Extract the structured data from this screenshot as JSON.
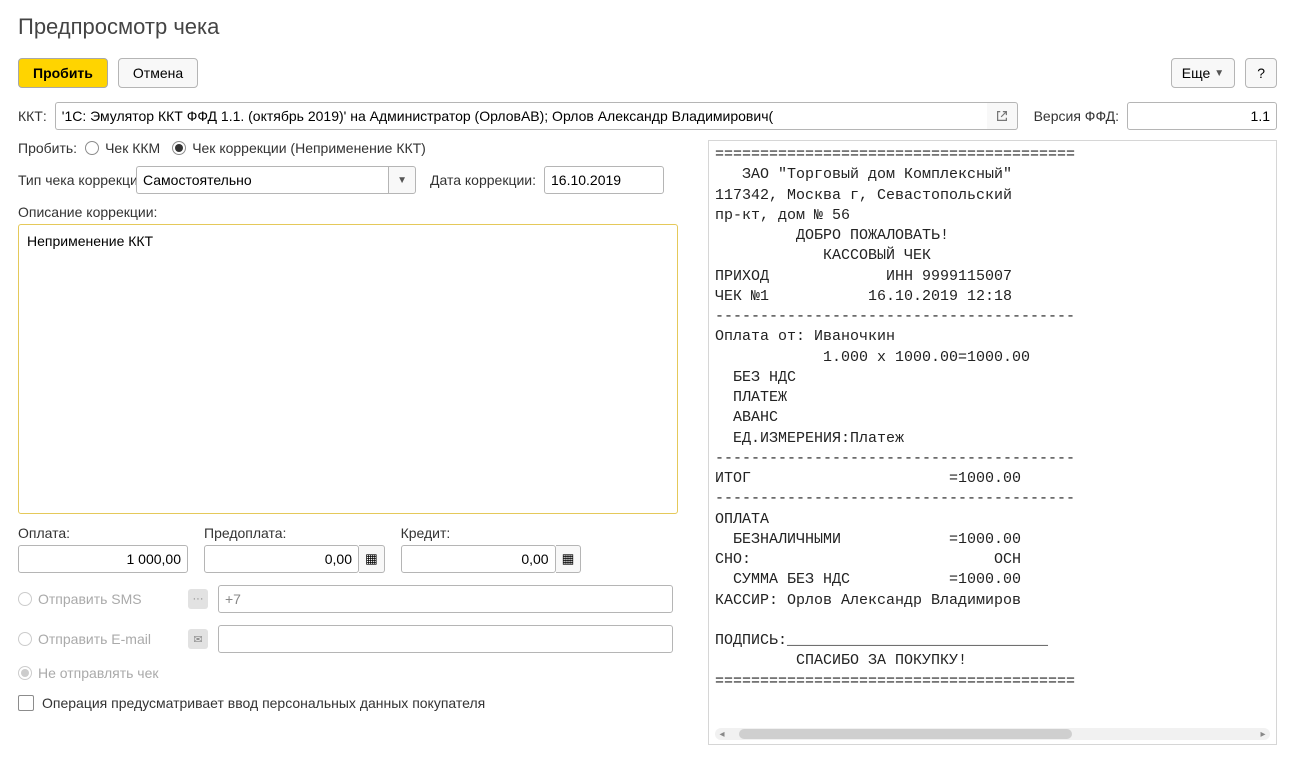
{
  "title": "Предпросмотр чека",
  "toolbar": {
    "punch": "Пробить",
    "cancel": "Отмена",
    "more": "Еще",
    "help": "?"
  },
  "kkt": {
    "label": "ККТ:",
    "value": "'1С: Эмулятор ККТ ФФД 1.1. (октябрь 2019)' на Администратор (ОрловАВ); Орлов Александр Владимирович(",
    "version_label": "Версия ФФД:",
    "version_value": "1.1"
  },
  "punch_mode": {
    "label": "Пробить:",
    "opt_kkm": "Чек ККМ",
    "opt_corr": "Чек коррекции (Неприменение ККТ)"
  },
  "corr": {
    "type_label": "Тип чека коррекции:",
    "type_value": "Самостоятельно",
    "date_label": "Дата коррекции:",
    "date_value": "16.10.2019",
    "desc_label": "Описание коррекции:",
    "desc_value": "Неприменение ККТ"
  },
  "amounts": {
    "pay_label": "Оплата:",
    "pay_value": "1 000,00",
    "prepay_label": "Предоплата:",
    "prepay_value": "0,00",
    "credit_label": "Кредит:",
    "credit_value": "0,00"
  },
  "send": {
    "sms_label": "Отправить SMS",
    "sms_value": "+7",
    "email_label": "Отправить E-mail",
    "none_label": "Не отправлять чек"
  },
  "personal": {
    "label": "Операция предусматривает ввод персональных данных покупателя"
  },
  "receipt_text": "========================================\n   ЗАО \"Торговый дом Комплексный\"\n117342, Москва г, Севастопольский \nпр-кт, дом № 56\n         ДОБРО ПОЖАЛОВАТЬ!\n            КАССОВЫЙ ЧЕК\nПРИХОД             ИНН 9999115007\nЧЕК №1           16.10.2019 12:18\n----------------------------------------\nОплата от: Иваночкин\n            1.000 x 1000.00=1000.00\n  БЕЗ НДС\n  ПЛАТЕЖ\n  АВАНС\n  ЕД.ИЗМЕРЕНИЯ:Платеж\n----------------------------------------\nИТОГ                      =1000.00\n----------------------------------------\nОПЛАТА\n  БЕЗНАЛИЧНЫМИ            =1000.00\nСНО:                           ОСН\n  СУММА БЕЗ НДС           =1000.00\nКАССИР: Орлов Александр Владимиров\n\nПОДПИСЬ:_____________________________\n         СПАСИБО ЗА ПОКУПКУ!\n========================================"
}
